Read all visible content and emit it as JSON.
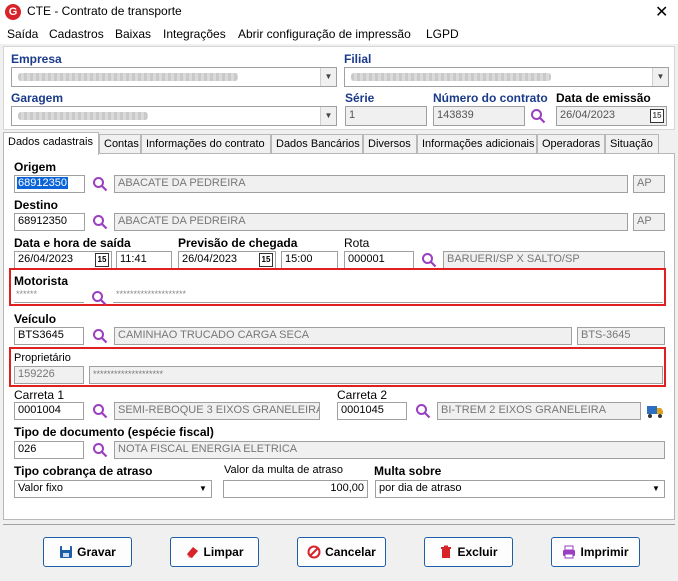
{
  "window": {
    "title": "CTE - Contrato de transporte",
    "close_glyph": "✕"
  },
  "menu": [
    "Saída",
    "Cadastros",
    "Baixas",
    "Integrações",
    "Abrir configuração de impressão",
    "LGPD"
  ],
  "header": {
    "empresa_label": "Empresa",
    "filial_label": "Filial",
    "garagem_label": "Garagem",
    "serie_label": "Série",
    "serie_value": "1",
    "numero_label": "Número do contrato",
    "numero_value": "143839",
    "data_emissao_label": "Data de emissão",
    "data_emissao_value": "26/04/2023"
  },
  "tabs": [
    "Dados cadastrais",
    "Contas",
    "Informações do contrato",
    "Dados Bancários",
    "Diversos",
    "Informações adicionais",
    "Operadoras",
    "Situação"
  ],
  "form": {
    "origem_label": "Origem",
    "origem_code": "68912350",
    "origem_name": "ABACATE DA PEDREIRA",
    "origem_uf": "AP",
    "destino_label": "Destino",
    "destino_code": "68912350",
    "destino_name": "ABACATE DA PEDREIRA",
    "destino_uf": "AP",
    "saida_label": "Data e hora de saída",
    "saida_date": "26/04/2023",
    "saida_time": "11:41",
    "chegada_label": "Previsão de chegada",
    "chegada_date": "26/04/2023",
    "chegada_time": "15:00",
    "rota_label": "Rota",
    "rota_code": "000001",
    "rota_name": "BARUERI/SP X SALTO/SP",
    "motorista_label": "Motorista",
    "motorista_code": "******",
    "motorista_name": "********************",
    "veiculo_label": "Veículo",
    "veiculo_code": "BTS3645",
    "veiculo_name": "CAMINHAO TRUCADO CARGA SECA",
    "veiculo_plate": "BTS-3645",
    "proprietario_label": "Proprietário",
    "proprietario_code": "159226",
    "proprietario_name": "********************",
    "carreta1_label": "Carreta 1",
    "carreta1_code": "0001004",
    "carreta1_name": "SEMI-REBOQUE 3 EIXOS GRANELEIRA.",
    "carreta2_label": "Carreta 2",
    "carreta2_code": "0001045",
    "carreta2_name": "BI-TREM 2 EIXOS GRANELEIRA",
    "tipo_doc_label": "Tipo de documento (espécie fiscal)",
    "tipo_doc_code": "026",
    "tipo_doc_name": "NOTA FISCAL ENERGIA ELETRICA",
    "cobranca_label": "Tipo cobrança de atraso",
    "cobranca_value": "Valor fixo",
    "multa_valor_label": "Valor da multa de atraso",
    "multa_valor": "100,00",
    "multa_sobre_label": "Multa sobre",
    "multa_sobre_value": "por dia de atraso"
  },
  "buttons": {
    "gravar": "Gravar",
    "limpar": "Limpar",
    "cancelar": "Cancelar",
    "excluir": "Excluir",
    "imprimir": "Imprimir"
  },
  "colors": {
    "label_blue": "#1a3a8a",
    "highlight_red": "#e02020",
    "search_purple": "#9a3fc0",
    "button_border": "#1d5ea8"
  }
}
